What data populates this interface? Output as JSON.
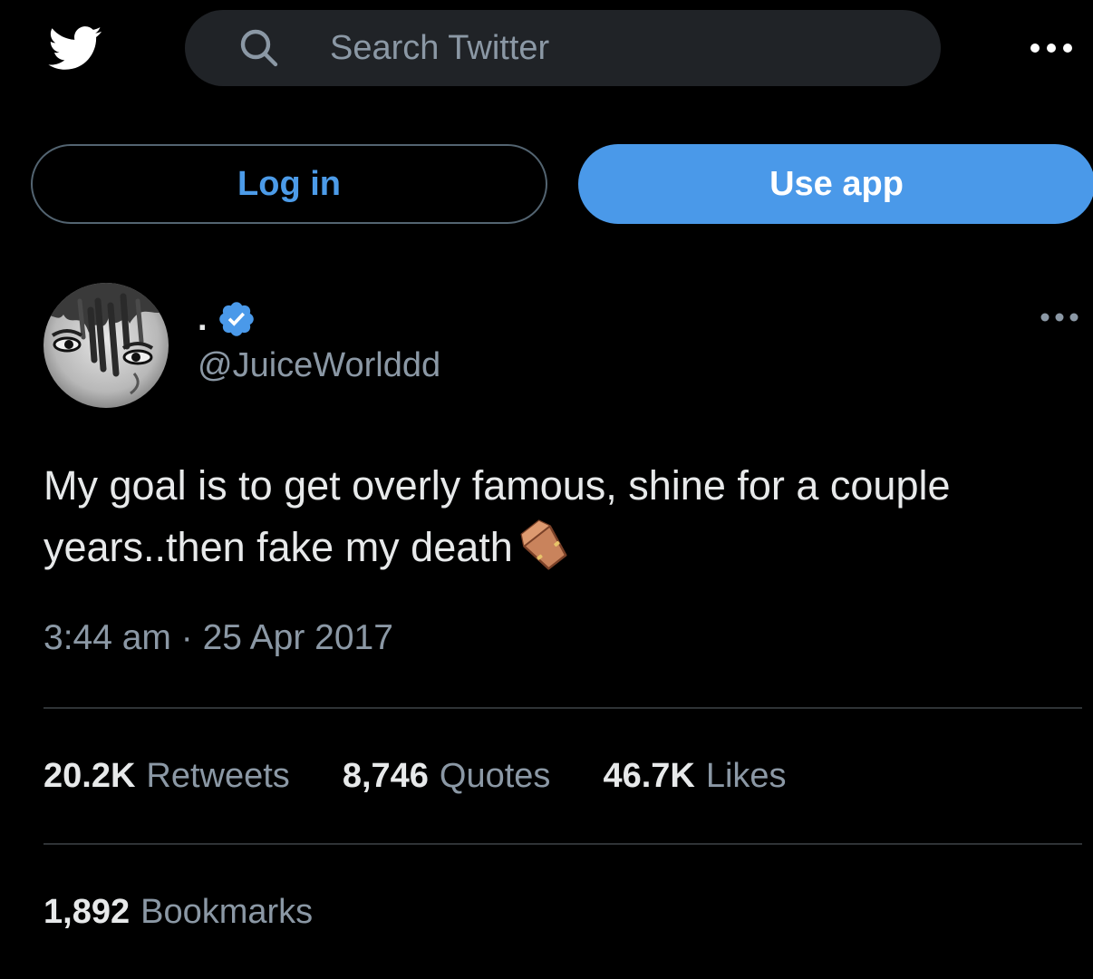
{
  "header": {
    "logo_icon": "twitter-bird-icon",
    "search": {
      "placeholder": "Search Twitter",
      "value": "",
      "icon": "search-icon"
    },
    "more_icon": "more-horizontal-icon"
  },
  "auth": {
    "login_label": "Log in",
    "use_app_label": "Use app"
  },
  "tweet": {
    "author": {
      "display_name": ".",
      "handle": "@JuiceWorlddd",
      "verified": true
    },
    "text": "My goal is to get overly famous, shine for a couple years..then fake my death",
    "emoji_icon": "coffin-icon",
    "timestamp": "3:44 am · 25 Apr 2017",
    "stats": {
      "retweets_count": "20.2K",
      "retweets_label": "Retweets",
      "quotes_count": "8,746",
      "quotes_label": "Quotes",
      "likes_count": "46.7K",
      "likes_label": "Likes",
      "bookmarks_count": "1,892",
      "bookmarks_label": "Bookmarks"
    }
  },
  "colors": {
    "background": "#000000",
    "accent": "#4a99e9",
    "text_primary": "#e7e9ea",
    "text_secondary": "#8b98a5",
    "search_bg": "#202327",
    "divider": "#2f3336"
  }
}
